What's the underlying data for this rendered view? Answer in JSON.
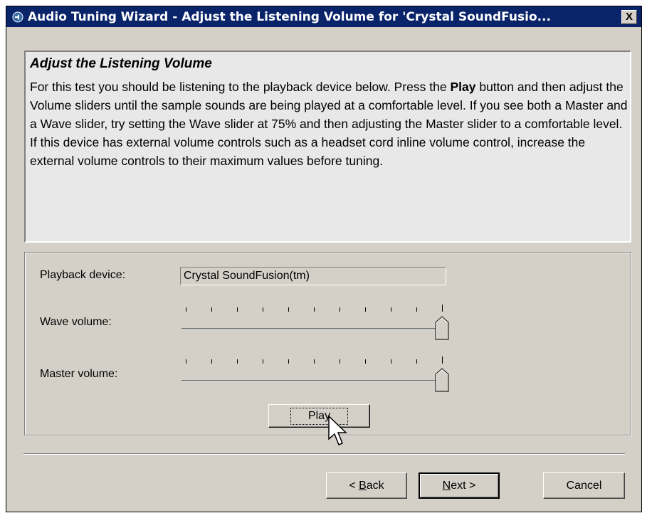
{
  "window": {
    "title": "Audio Tuning Wizard - Adjust the Listening Volume for 'Crystal SoundFusio...",
    "close_label": "X",
    "icon": "audio-wizard-icon"
  },
  "info": {
    "heading": "Adjust the Listening Volume",
    "body_before_bold": "For this test you should be listening to the playback device below. Press the ",
    "body_bold": "Play",
    "body_after_bold": " button and then adjust the Volume sliders until the sample sounds are being played at a comfortable level. If you see both a Master and a Wave slider, try setting the Wave slider at 75% and then adjusting the Master slider to a comfortable level. If this device has external volume controls such as a headset cord inline volume control, increase the external volume controls to their maximum values before tuning."
  },
  "device": {
    "label": "Playback device:",
    "value": "Crystal SoundFusion(tm)"
  },
  "wave": {
    "label": "Wave volume:",
    "level": 1.0,
    "tick_count": 11
  },
  "master": {
    "label": "Master volume:",
    "level": 1.0,
    "tick_count": 11
  },
  "play_label": "Play",
  "buttons": {
    "back_prefix": "< ",
    "back_mnemonic": "B",
    "back_rest": "ack",
    "next_mnemonic": "N",
    "next_rest": "ext >",
    "cancel": "Cancel"
  },
  "colors": {
    "titlebar": "#0a246a",
    "face": "#d4d0c8"
  }
}
